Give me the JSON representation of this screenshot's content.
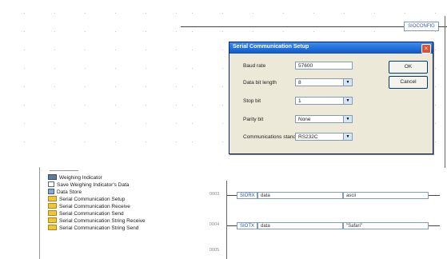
{
  "ladder": {
    "top_instruction": "SIOCONFIG"
  },
  "dialog": {
    "title": "Serial Communication Setup",
    "fields": [
      {
        "label": "Baud rate",
        "value": "57600"
      },
      {
        "label": "Data bit length",
        "value": "8"
      },
      {
        "label": "Stop bit",
        "value": "1"
      },
      {
        "label": "Parity bit",
        "value": "None"
      },
      {
        "label": "Communications standard",
        "value": "RS232C"
      }
    ],
    "ok_label": "OK",
    "cancel_label": "Cancel"
  },
  "tree": {
    "items": [
      {
        "label": "Weighing Indicator",
        "icon": "scale-icon"
      },
      {
        "label": "Save Weighing Indicator's Data",
        "icon": "document-icon"
      },
      {
        "label": "Data Store",
        "icon": "data-store-icon"
      },
      {
        "label": "Serial Communication Setup",
        "icon": "function-icon"
      },
      {
        "label": "Serial Communication Receive",
        "icon": "function-icon"
      },
      {
        "label": "Serial Communication Send",
        "icon": "function-icon"
      },
      {
        "label": "Serial Communication String Receive",
        "icon": "function-icon"
      },
      {
        "label": "Serial Communication String Send",
        "icon": "function-icon"
      }
    ]
  },
  "rungs": [
    {
      "number": "0003",
      "instruction": "SIORX",
      "operand": "data",
      "value": "ascii"
    },
    {
      "number": "0004",
      "instruction": "SIOTX",
      "operand": "data",
      "value": "\"Safari\""
    },
    {
      "number": "0005"
    }
  ]
}
